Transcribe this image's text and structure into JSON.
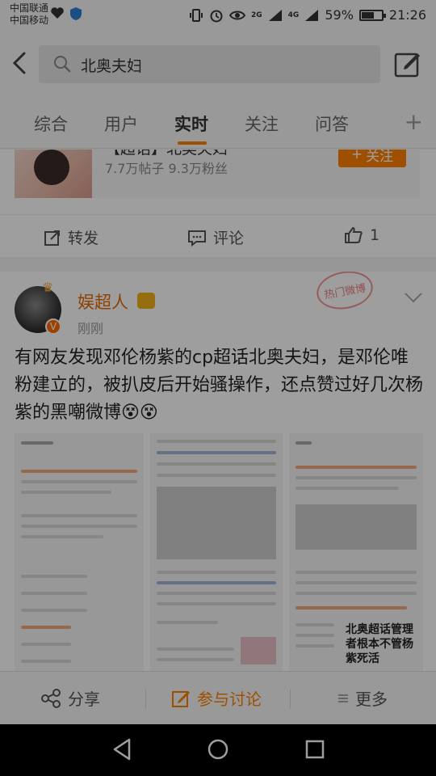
{
  "status_bar": {
    "carrier1": "中国联通",
    "carrier2": "中国移动",
    "signal_4g": "4G",
    "signal_2g": "2G",
    "battery": "59%",
    "time": "21:26"
  },
  "header": {
    "search_query": "北奥夫妇",
    "back_icon": "back-arrow-icon",
    "compose_icon": "compose-icon"
  },
  "tabs": [
    {
      "label": "综合",
      "active": false
    },
    {
      "label": "用户",
      "active": false
    },
    {
      "label": "实时",
      "active": true
    },
    {
      "label": "关注",
      "active": false
    },
    {
      "label": "问答",
      "active": false
    }
  ],
  "tab_add": "+",
  "topic_card": {
    "title": "【超话】北奥夫妇",
    "stats": "7.7万帖子  9.3万粉丝",
    "follow_label": "关注",
    "repost_label": "转发",
    "comment_label": "评论",
    "like_count": "1"
  },
  "post": {
    "username": "娱超人",
    "time": "刚刚",
    "stamp": "热门微博",
    "text": "有网友发现邓伦杨紫的cp超话北奥夫妇，是邓伦唯粉建立的，被扒皮后开始骚操作，还点赞过好几次杨紫的黑嘲微博😵😵",
    "image_caption": "北奥超话管理者根本不管杨紫死活"
  },
  "bottom_bar": {
    "share": "分享",
    "discuss": "参与讨论",
    "more": "更多"
  },
  "colors": {
    "accent": "#ff8200",
    "username": "#e66a00"
  }
}
